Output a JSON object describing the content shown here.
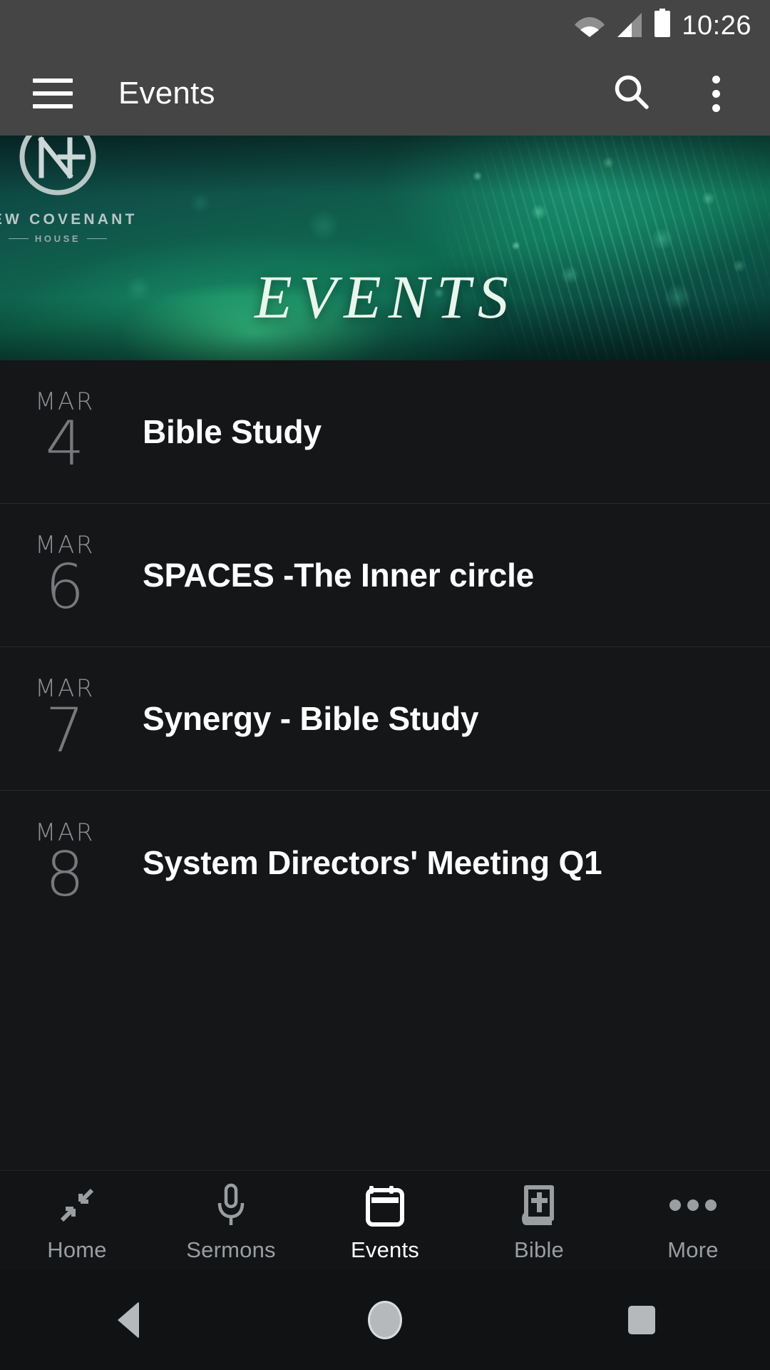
{
  "status_bar": {
    "time": "10:26",
    "icons": [
      "wifi-icon",
      "cell-signal-icon",
      "battery-icon"
    ]
  },
  "app_bar": {
    "menu_icon": "hamburger-menu-icon",
    "title": "Events",
    "search_icon": "search-icon",
    "overflow_icon": "overflow-menu-icon"
  },
  "hero": {
    "banner_title": "EVENTS",
    "logo_monogram": "NH",
    "logo_name": "NEW COVENANT",
    "logo_sub": "HOUSE",
    "accent_color": "#0e6b4f",
    "glow_color": "#3fe096"
  },
  "events": [
    {
      "month": "MAR",
      "day": "4",
      "title": "Bible Study"
    },
    {
      "month": "MAR",
      "day": "6",
      "title": "SPACES -The Inner circle"
    },
    {
      "month": "MAR",
      "day": "7",
      "title": "Synergy - Bible Study"
    },
    {
      "month": "MAR",
      "day": "8",
      "title": "System Directors' Meeting Q1"
    }
  ],
  "tabs": [
    {
      "label": "Home",
      "icon": "compress-arrows-icon",
      "active": false
    },
    {
      "label": "Sermons",
      "icon": "microphone-icon",
      "active": false
    },
    {
      "label": "Events",
      "icon": "calendar-icon",
      "active": true
    },
    {
      "label": "Bible",
      "icon": "book-cross-icon",
      "active": false
    },
    {
      "label": "More",
      "icon": "ellipsis-icon",
      "active": false
    }
  ],
  "system_nav": {
    "back": "back-triangle-icon",
    "home": "home-circle-icon",
    "recents": "recents-square-icon"
  },
  "colors": {
    "status_bar_bg": "#454545",
    "list_bg": "#141618",
    "tab_active": "#ffffff",
    "tab_inactive": "#9b9ea1"
  }
}
